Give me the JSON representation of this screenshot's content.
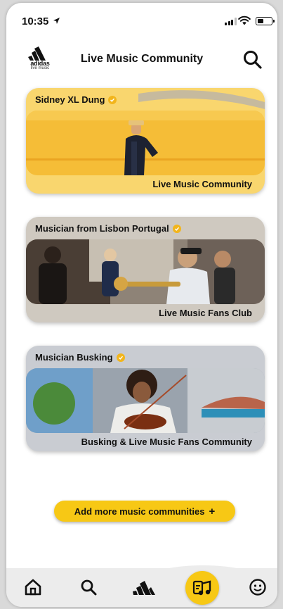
{
  "status_bar": {
    "time": "10:35"
  },
  "header": {
    "logo_text": "adidas",
    "logo_subtext": "live music",
    "title": "Live Music Community"
  },
  "communities": [
    {
      "name": "Sidney XL Dung",
      "label": "Live Music Community"
    },
    {
      "name": "Musician from Lisbon Portugal",
      "label": "Live Music Fans Club"
    },
    {
      "name": "Musician Busking",
      "label": "Busking & Live Music Fans Community"
    }
  ],
  "add_button": {
    "label": "Add more music communities",
    "icon": "+"
  },
  "tab_bar": {
    "items": [
      "home-icon",
      "search-icon",
      "adidas-icon",
      "music-community-icon",
      "profile-icon"
    ],
    "active": "music-community-icon"
  },
  "colors": {
    "accent": "#f7c815",
    "verified": "#f2b51c"
  }
}
